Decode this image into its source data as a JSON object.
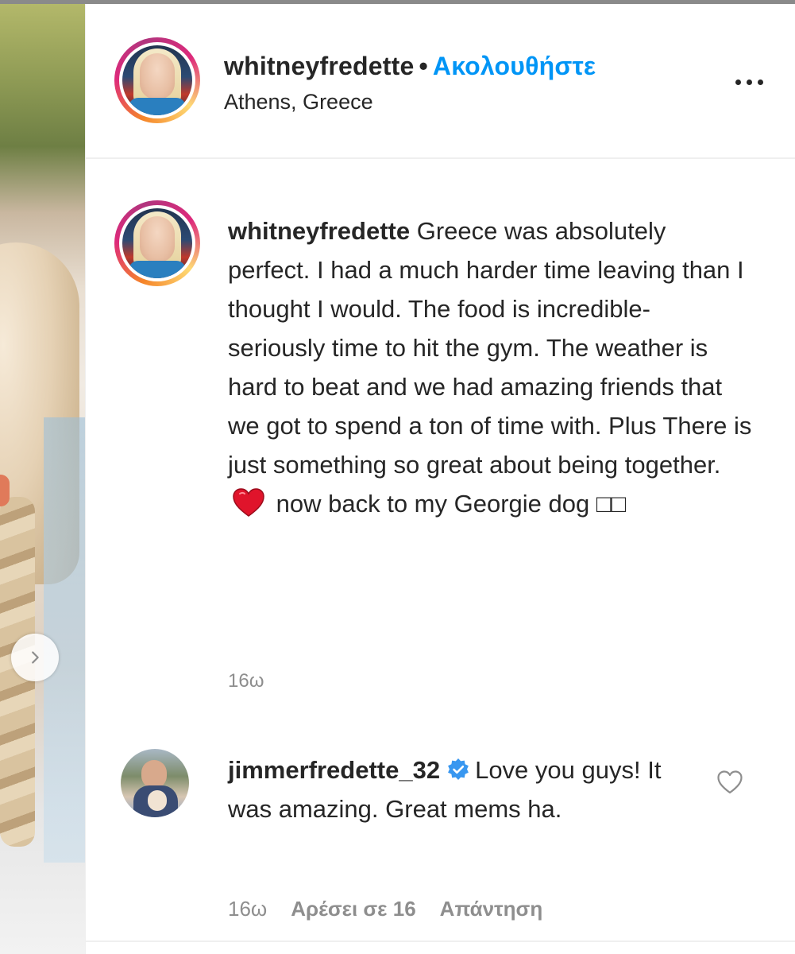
{
  "post": {
    "username": "whitneyfredette",
    "separator": "•",
    "follow_label": "Ακολουθήστε",
    "location": "Athens, Greece",
    "more_icon": "more-horizontal-icon",
    "next_icon": "chevron-right-icon"
  },
  "caption": {
    "username": "whitneyfredette",
    "text_before_emoji": "Greece was absolutely perfect. I had a much harder time leaving than I thought I would. The food is incredible- seriously time to hit the gym. The weather is hard to beat and we had amazing friends that we got to spend a ton of time with. Plus There is just something so great about being together.",
    "emoji": "heart-emoji",
    "text_after_emoji": "now back to my Georgie dog □□",
    "time": "16ω"
  },
  "comment": {
    "username": "jimmerfredette_32",
    "verified_icon": "verified-badge-icon",
    "text": "Love you guys! It was amazing. Great mems ha.",
    "time": "16ω",
    "likes": "Αρέσει σε 16",
    "reply_label": "Απάντηση",
    "like_icon": "heart-outline-icon"
  },
  "colors": {
    "accent_blue": "#0095f6",
    "text": "#262626",
    "muted": "#8e8e8e",
    "heart_red": "#e0142b"
  }
}
